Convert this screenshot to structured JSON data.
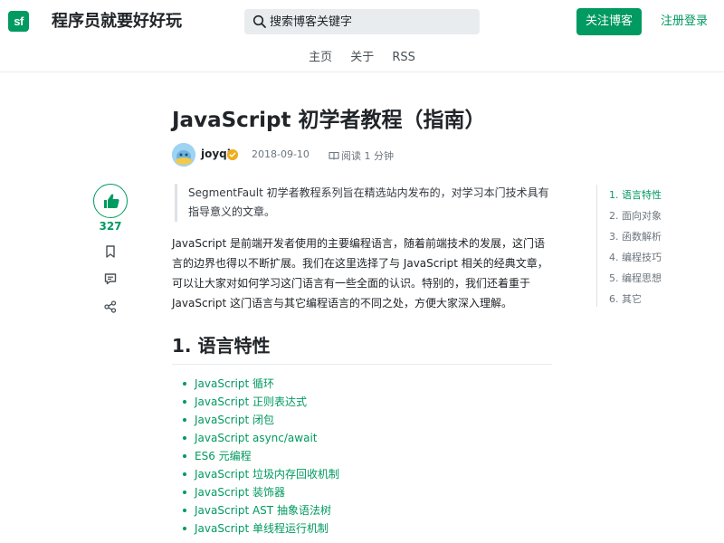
{
  "header": {
    "logo_text": "sf",
    "site_title": "程序员就要好好玩",
    "search_placeholder": "搜索博客关键字",
    "follow_label": "关注博客",
    "login_label": "注册登录",
    "brand_color": "#019a61"
  },
  "nav": {
    "items": [
      {
        "label": "主页"
      },
      {
        "label": "关于"
      },
      {
        "label": "RSS"
      }
    ]
  },
  "rail": {
    "like_count": "327",
    "icons": [
      "thumbs-up-icon",
      "bookmark-icon",
      "comment-icon",
      "share-icon"
    ]
  },
  "article": {
    "title": "JavaScript 初学者教程（指南）",
    "author": "joyqi",
    "date": "2018-09-10",
    "read_time": "阅读 1 分钟",
    "quote": "SegmentFault 初学者教程系列旨在精选站内发布的，对学习本门技术具有指导意义的文章。",
    "intro": "JavaScript 是前端开发者使用的主要编程语言，随着前端技术的发展，这门语言的边界也得以不断扩展。我们在这里选择了与 JavaScript 相关的经典文章，可以让大家对如何学习这门语言有一些全面的认识。特别的，我们还着重于 JavaScript 这门语言与其它编程语言的不同之处，方便大家深入理解。",
    "section_heading": "1. 语言特性",
    "links": [
      {
        "label": "JavaScript 循环"
      },
      {
        "label": "JavaScript 正则表达式"
      },
      {
        "label": "JavaScript 闭包"
      },
      {
        "label": "JavaScript async/await"
      },
      {
        "label": "ES6 元编程"
      },
      {
        "label": "JavaScript 垃圾内存回收机制"
      },
      {
        "label": "JavaScript 装饰器"
      },
      {
        "label": "JavaScript AST 抽象语法树"
      },
      {
        "label": "JavaScript 单线程运行机制"
      }
    ]
  },
  "toc": {
    "items": [
      {
        "label": "1. 语言特性",
        "active": true
      },
      {
        "label": "2. 面向对象",
        "active": false
      },
      {
        "label": "3. 函数解析",
        "active": false
      },
      {
        "label": "4. 编程技巧",
        "active": false
      },
      {
        "label": "5. 编程思想",
        "active": false
      },
      {
        "label": "6. 其它",
        "active": false
      }
    ]
  }
}
